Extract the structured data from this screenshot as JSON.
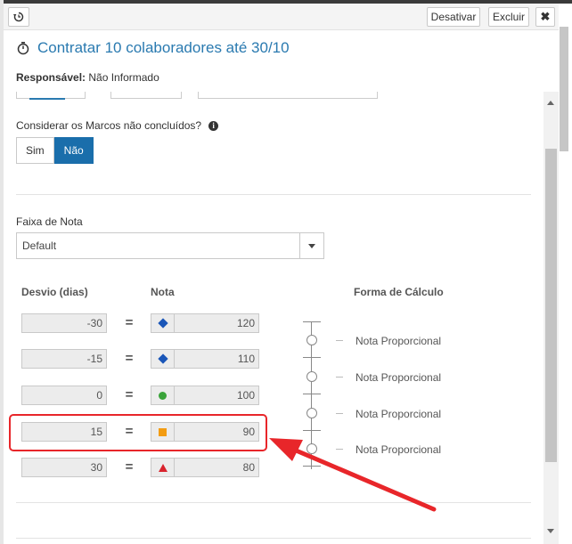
{
  "toolbar": {
    "deactivate_label": "Desativar",
    "delete_label": "Excluir",
    "close_label": "✖",
    "history_icon": "history-icon"
  },
  "title": "Contratar 10 colaboradores até 30/10",
  "responsavel": {
    "label": "Responsável:",
    "value": "Não Informado"
  },
  "marcos": {
    "question": "Considerar os Marcos não concluídos?",
    "info_icon": "info-icon",
    "options": [
      "Sim",
      "Não"
    ],
    "selected": "Não"
  },
  "faixa": {
    "label": "Faixa de Nota",
    "selected": "Default"
  },
  "table": {
    "col_desvio": "Desvio (dias)",
    "col_nota": "Nota",
    "col_forma": "Forma de Cálculo",
    "rows": [
      {
        "desvio": "-30",
        "nota": "120",
        "shape": "diamond",
        "color": "#1a56b8"
      },
      {
        "desvio": "-15",
        "nota": "110",
        "shape": "diamond",
        "color": "#1a56b8"
      },
      {
        "desvio": "0",
        "nota": "100",
        "shape": "circle",
        "color": "#3aa33a"
      },
      {
        "desvio": "15",
        "nota": "90",
        "shape": "square",
        "color": "#f39c12"
      },
      {
        "desvio": "30",
        "nota": "80",
        "shape": "triangle",
        "color": "#d9232d"
      }
    ],
    "calc": [
      "Nota Proporcional",
      "Nota Proporcional",
      "Nota Proporcional",
      "Nota Proporcional"
    ]
  },
  "colors": {
    "accent": "#2a7ab0",
    "toggle_active": "#1a6eab",
    "annotation": "#e8262a"
  }
}
